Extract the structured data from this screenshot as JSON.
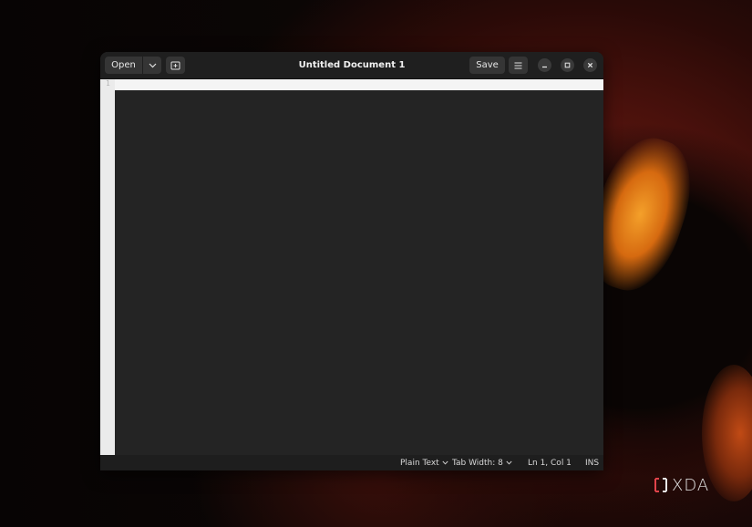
{
  "window": {
    "title": "Untitled Document 1"
  },
  "header": {
    "open_label": "Open",
    "save_label": "Save"
  },
  "icons": {
    "open_menu": "chevron-down-icon",
    "new_tab": "new-tab-icon",
    "main_menu": "hamburger-menu-icon",
    "minimize": "minimize-icon",
    "maximize": "maximize-icon",
    "close": "close-icon"
  },
  "editor": {
    "line_number": "1",
    "content": ""
  },
  "statusbar": {
    "language": "Plain Text",
    "tab_width": "Tab Width: 8",
    "cursor_position": "Ln 1, Col 1",
    "insert_mode": "INS"
  },
  "watermark": {
    "brand": "XDA"
  },
  "colors": {
    "window_bg": "#242424",
    "header_bg": "#1f1f1f",
    "button_bg": "#353535",
    "gutter_bg": "#ebebeb",
    "watermark_accent": "#e0434a"
  }
}
